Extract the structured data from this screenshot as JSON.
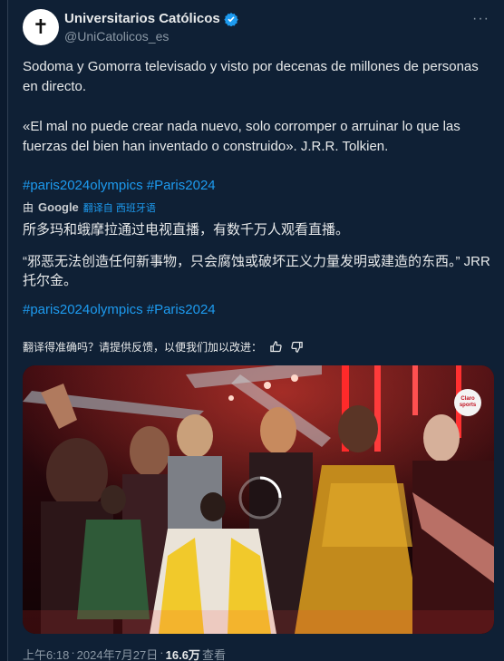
{
  "account": {
    "name": "Universitarios Católicos",
    "handle": "@UniCatolicos_es",
    "avatar_symbol": "✝",
    "verified_color": "#1d9bf0",
    "more_label": "···"
  },
  "post": {
    "paragraph1": "Sodoma y Gomorra televisado y visto por  decenas de millones de personas en directo.",
    "paragraph2": "«El mal no puede crear nada nuevo, solo corromper o arruinar lo que las fuerzas del bien han inventado o construido». J.R.R. Tolkien.",
    "hashtags": "#paris2024olympics #Paris2024"
  },
  "translation": {
    "prefix": "由",
    "provider": "Google",
    "link": "翻译自 西班牙语",
    "zh_paragraph1": "所多玛和蛾摩拉通过电视直播，有数千万人观看直播。",
    "zh_paragraph2": "“邪恶无法创造任何新事物，只会腐蚀或破坏正义力量发明或建造的东西。” JRR托尔金。",
    "hashtags": "#paris2024olympics #Paris2024",
    "feedback": "翻译得准确吗？请提供反馈，以便我们加以改进："
  },
  "media": {
    "description_icon": "video-loading-spinner",
    "channel_badge": "Claro sports"
  },
  "meta": {
    "time": "上午6:18",
    "separator": " · ",
    "date": "2024年7月27日",
    "views": "16.6万",
    "views_label": " 查看"
  },
  "colors": {
    "background": "#0f2035",
    "link": "#1d9bf0",
    "muted": "#8b98a5"
  }
}
